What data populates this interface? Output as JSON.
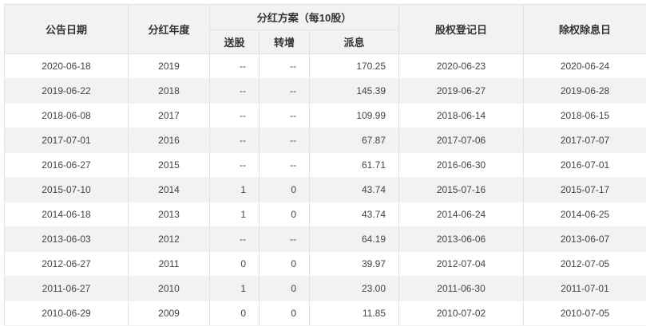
{
  "headers": {
    "announce_date": "公告日期",
    "year": "分红年度",
    "plan": "分红方案（每10股）",
    "bonus": "送股",
    "transfer": "转增",
    "dividend": "派息",
    "record_date": "股权登记日",
    "ex_date": "除权除息日"
  },
  "rows": [
    [
      "2020-06-18",
      "2019",
      "--",
      "--",
      "170.25",
      "2020-06-23",
      "2020-06-24"
    ],
    [
      "2019-06-22",
      "2018",
      "--",
      "--",
      "145.39",
      "2019-06-27",
      "2019-06-28"
    ],
    [
      "2018-06-08",
      "2017",
      "--",
      "--",
      "109.99",
      "2018-06-14",
      "2018-06-15"
    ],
    [
      "2017-07-01",
      "2016",
      "--",
      "--",
      "67.87",
      "2017-07-06",
      "2017-07-07"
    ],
    [
      "2016-06-27",
      "2015",
      "--",
      "--",
      "61.71",
      "2016-06-30",
      "2016-07-01"
    ],
    [
      "2015-07-10",
      "2014",
      "1",
      "0",
      "43.74",
      "2015-07-16",
      "2015-07-17"
    ],
    [
      "2014-06-18",
      "2013",
      "1",
      "0",
      "43.74",
      "2014-06-24",
      "2014-06-25"
    ],
    [
      "2013-06-03",
      "2012",
      "--",
      "--",
      "64.19",
      "2013-06-06",
      "2013-06-07"
    ],
    [
      "2012-06-27",
      "2011",
      "0",
      "0",
      "39.97",
      "2012-07-04",
      "2012-07-05"
    ],
    [
      "2011-06-27",
      "2010",
      "1",
      "0",
      "23.00",
      "2011-06-30",
      "2011-07-01"
    ],
    [
      "2010-06-29",
      "2009",
      "0",
      "0",
      "11.85",
      "2010-07-02",
      "2010-07-05"
    ]
  ]
}
